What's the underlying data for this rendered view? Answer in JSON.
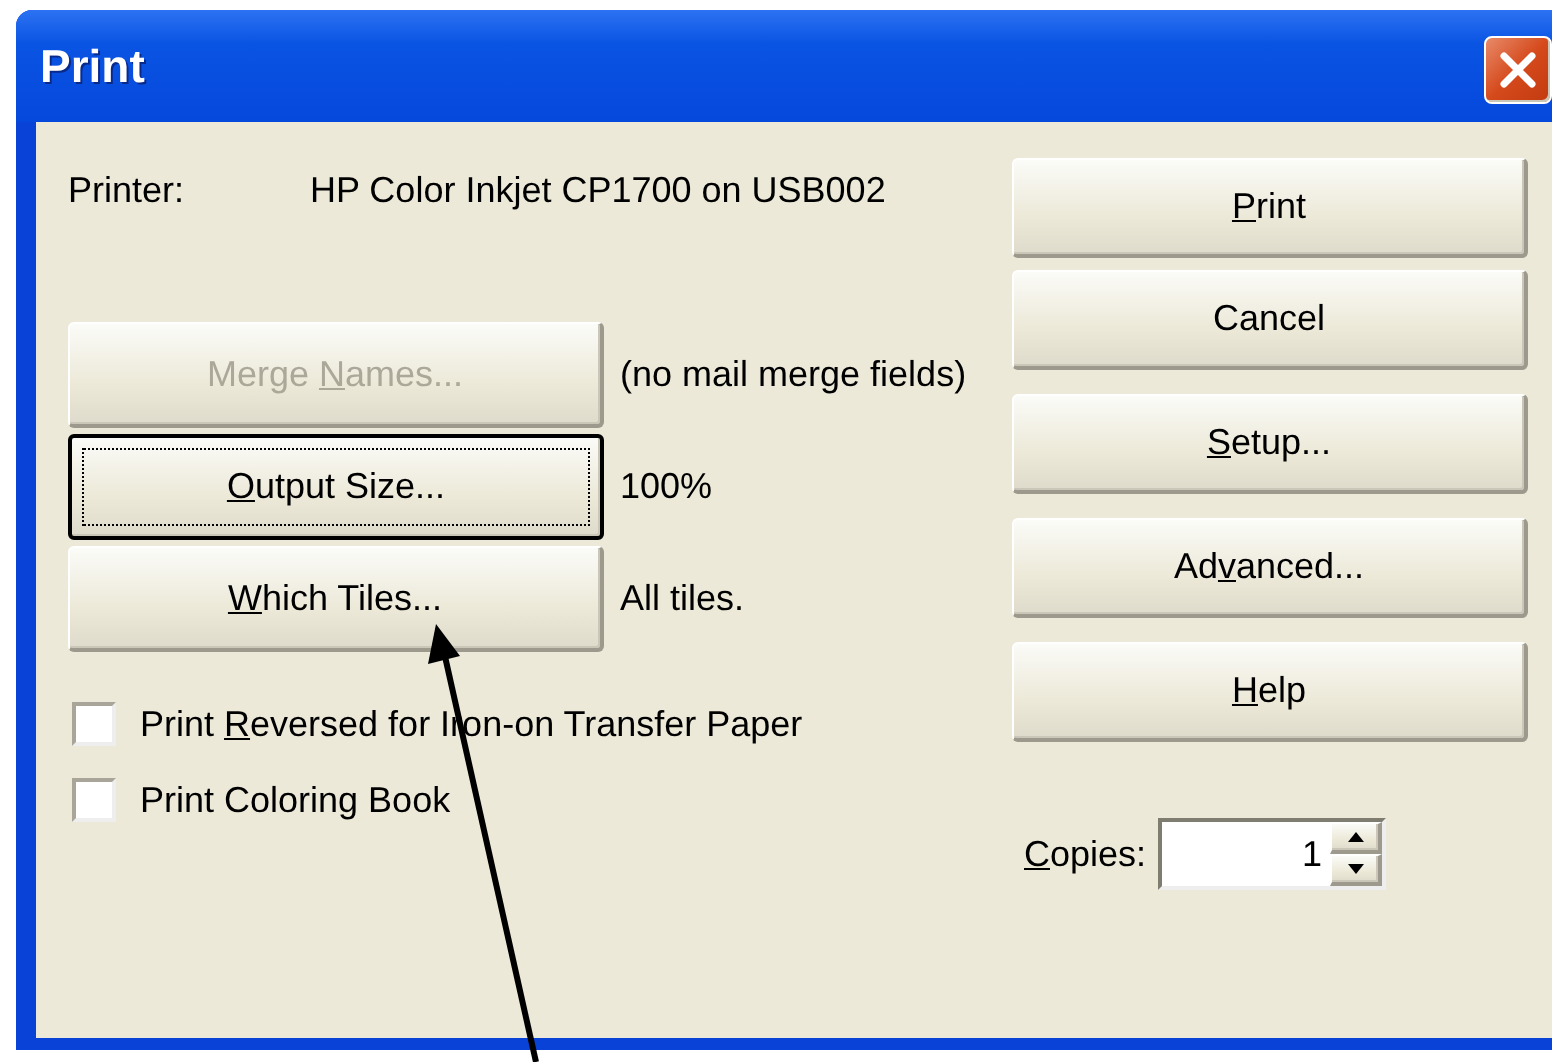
{
  "window": {
    "title": "Print"
  },
  "printer": {
    "label": "Printer:",
    "value": "HP Color Inkjet CP1700 on USB002"
  },
  "option_buttons": [
    {
      "label_parts": [
        {
          "text": "Merge ",
          "underlined": false
        },
        {
          "text": "N",
          "underlined": true
        },
        {
          "text": "ames...",
          "underlined": false
        }
      ],
      "disabled": true,
      "focused": false,
      "note": "(no mail merge fields)"
    },
    {
      "label_parts": [
        {
          "text": "O",
          "underlined": true
        },
        {
          "text": "utput Size...",
          "underlined": false
        }
      ],
      "disabled": false,
      "focused": true,
      "note": "100%"
    },
    {
      "label_parts": [
        {
          "text": "W",
          "underlined": true
        },
        {
          "text": "hich Tiles...",
          "underlined": false
        }
      ],
      "disabled": false,
      "focused": false,
      "note": "All tiles."
    }
  ],
  "checkboxes": [
    {
      "label_parts": [
        {
          "text": "Print ",
          "underlined": false
        },
        {
          "text": "R",
          "underlined": true
        },
        {
          "text": "eversed for Iron-on Transfer Paper",
          "underlined": false
        }
      ],
      "checked": false
    },
    {
      "label_parts": [
        {
          "text": "Print Coloring Book",
          "underlined": false
        }
      ],
      "checked": false
    }
  ],
  "action_buttons": [
    {
      "label_parts": [
        {
          "text": "P",
          "underlined": true
        },
        {
          "text": "rint",
          "underlined": false
        }
      ]
    },
    {
      "label_parts": [
        {
          "text": "Cancel",
          "underlined": false
        }
      ]
    },
    {
      "label_parts": [
        {
          "text": "S",
          "underlined": true
        },
        {
          "text": "etup...",
          "underlined": false
        }
      ]
    },
    {
      "label_parts": [
        {
          "text": "Ad",
          "underlined": false
        },
        {
          "text": "v",
          "underlined": true
        },
        {
          "text": "anced...",
          "underlined": false
        }
      ]
    },
    {
      "label_parts": [
        {
          "text": "H",
          "underlined": true
        },
        {
          "text": "elp",
          "underlined": false
        }
      ]
    }
  ],
  "copies": {
    "label_parts": [
      {
        "text": "C",
        "underlined": true
      },
      {
        "text": "opies:",
        "underlined": false
      }
    ],
    "value": "1"
  }
}
